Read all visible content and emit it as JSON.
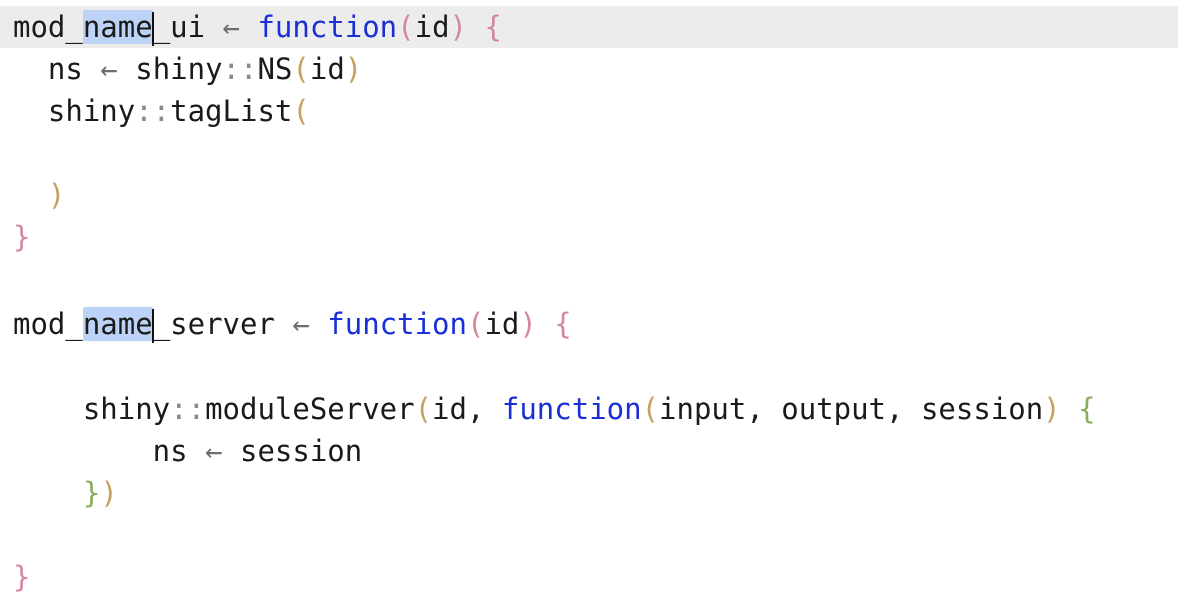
{
  "editor": {
    "selection_word": "name",
    "lines": [
      {
        "id": "l1",
        "parts": {
          "a": "mod_",
          "b": "name",
          "c": "_ui",
          "d": " ← ",
          "e": "function",
          "f": "(",
          "g": "id",
          "h": ")",
          "i": " {"
        }
      },
      {
        "id": "l2",
        "parts": {
          "a": "  ns",
          "b": " ← ",
          "c": "shiny",
          "d": "::",
          "e": "NS",
          "f": "(",
          "g": "id",
          "h": ")"
        }
      },
      {
        "id": "l3",
        "parts": {
          "a": "  shiny",
          "b": "::",
          "c": "tagList",
          "d": "("
        }
      },
      {
        "id": "l4",
        "parts": {}
      },
      {
        "id": "l5",
        "parts": {
          "a": "  )"
        }
      },
      {
        "id": "l6",
        "parts": {
          "a": "}"
        }
      },
      {
        "id": "l7",
        "parts": {}
      },
      {
        "id": "l8",
        "parts": {
          "a": "mod_",
          "b": "name",
          "c": "_server",
          "d": " ← ",
          "e": "function",
          "f": "(",
          "g": "id",
          "h": ")",
          "i": " {"
        }
      },
      {
        "id": "l9",
        "parts": {}
      },
      {
        "id": "l10",
        "parts": {
          "a": "    shiny",
          "b": "::",
          "c": "moduleServer",
          "d": "(",
          "e": "id, ",
          "f": "function",
          "g": "(",
          "h": "input, output, session",
          "i": ")",
          "j": " {"
        }
      },
      {
        "id": "l11",
        "parts": {
          "a": "        ns",
          "b": " ← ",
          "c": "session"
        }
      },
      {
        "id": "l12",
        "parts": {
          "a": "    }",
          "b": ")"
        }
      },
      {
        "id": "l13",
        "parts": {}
      },
      {
        "id": "l14",
        "parts": {
          "a": "}"
        }
      }
    ]
  }
}
